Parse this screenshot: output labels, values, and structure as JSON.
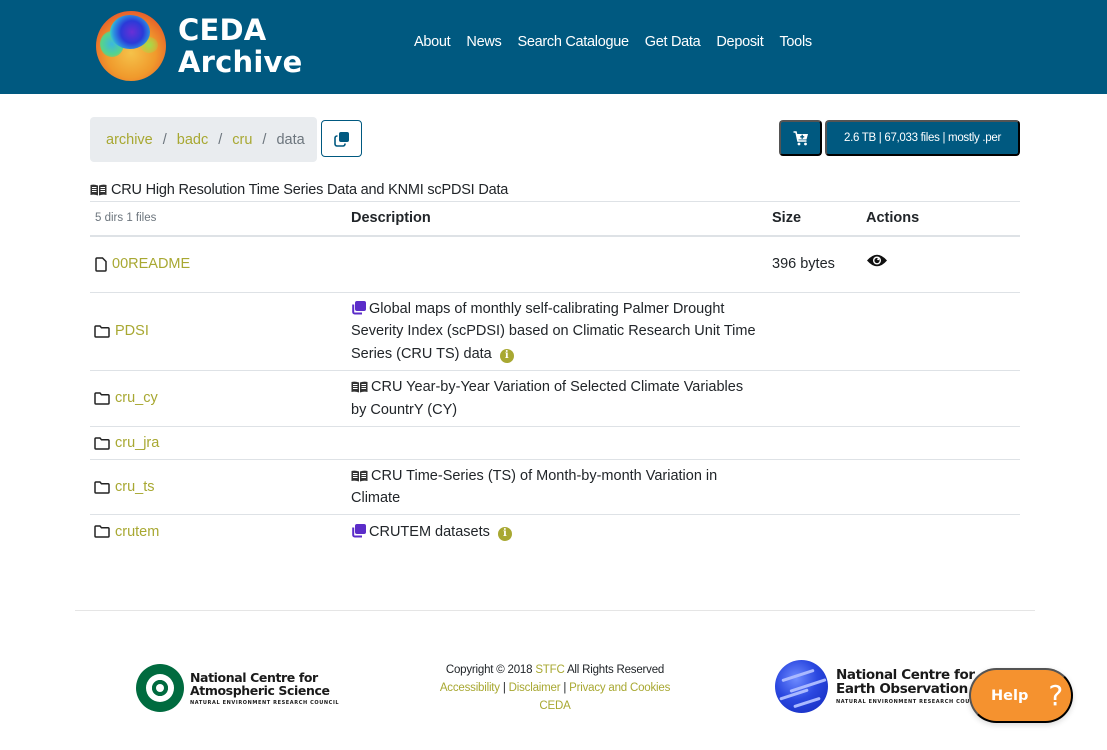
{
  "header": {
    "brand_line1": "CEDA",
    "brand_line2": "Archive",
    "nav": [
      "About",
      "News",
      "Search Catalogue",
      "Get Data",
      "Deposit",
      "Tools"
    ]
  },
  "breadcrumb": {
    "items": [
      "archive",
      "badc",
      "cru",
      "data"
    ],
    "separator": "/"
  },
  "toolbar": {
    "copy_icon": "copy-icon",
    "cart_icon": "cart-plus-icon",
    "stats": "2.6 TB | 67,033 files | mostly .per"
  },
  "dataset": {
    "icon": "book-open-icon",
    "title": "CRU High Resolution Time Series Data and KNMI scPDSI Data"
  },
  "table": {
    "counts": "5 dirs 1 files",
    "headers": {
      "description": "Description",
      "size": "Size",
      "actions": "Actions"
    },
    "rows": [
      {
        "type": "file",
        "name": "00README",
        "description": "",
        "desc_icon": "",
        "info": false,
        "size": "396 bytes",
        "action": "eye-icon"
      },
      {
        "type": "dir",
        "name": "PDSI",
        "description": "Global maps of monthly self-calibrating Palmer Drought Severity Index (scPDSI) based on Climatic Research Unit Time Series (CRU TS) data",
        "desc_icon": "collection-icon",
        "info": true,
        "size": "",
        "action": ""
      },
      {
        "type": "dir",
        "name": "cru_cy",
        "description": "CRU Year-by-Year Variation of Selected Climate Variables by CountrY (CY)",
        "desc_icon": "book-open-icon",
        "info": false,
        "size": "",
        "action": ""
      },
      {
        "type": "dir",
        "name": "cru_jra",
        "description": "",
        "desc_icon": "",
        "info": false,
        "size": "",
        "action": ""
      },
      {
        "type": "dir",
        "name": "cru_ts",
        "description": "CRU Time-Series (TS) of Month-by-month Variation in Climate",
        "desc_icon": "book-open-icon",
        "info": false,
        "size": "",
        "action": ""
      },
      {
        "type": "dir",
        "name": "crutem",
        "description": "CRUTEM datasets",
        "desc_icon": "collection-icon",
        "info": true,
        "size": "",
        "action": ""
      }
    ],
    "info_glyph": "i"
  },
  "footer": {
    "ncas": {
      "line1": "National Centre for",
      "line2": "Atmospheric Science",
      "line3": "NATURAL ENVIRONMENT RESEARCH COUNCIL"
    },
    "copyright_prefix": "Copyright © 2018",
    "stfc": "STFC",
    "rights": "All Rights Reserved",
    "links": [
      "Accessibility",
      "Disclaimer",
      "Privacy and Cookies"
    ],
    "link_sep": "|",
    "ceda": "CEDA",
    "nceo": {
      "line1": "National Centre for",
      "line2": "Earth Observation",
      "line3": "NATURAL ENVIRONMENT RESEARCH COUNCIL"
    }
  },
  "help": {
    "label": "Help",
    "glyph": "?"
  },
  "colors": {
    "brand": "#005980",
    "link": "#a8a832",
    "collection_icon": "#5b2cc9",
    "help": "#f5922f"
  }
}
